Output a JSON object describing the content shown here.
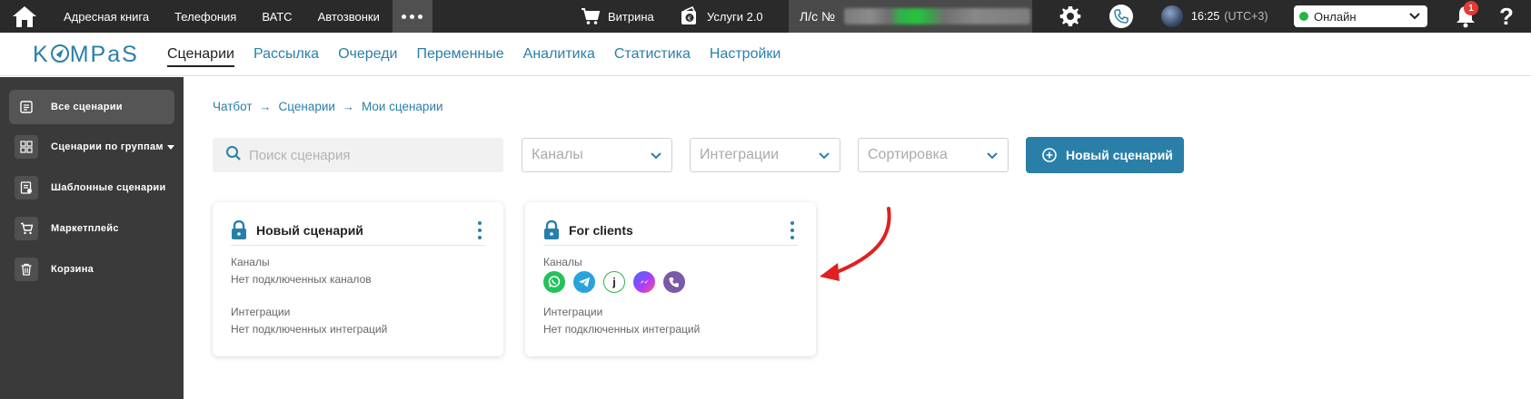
{
  "topbar": {
    "nav": [
      "Адресная книга",
      "Телефония",
      "ВАТС",
      "Автозвонки"
    ],
    "vitrina": "Витрина",
    "services": "Услуги 2.0",
    "account_label": "Л/с №",
    "time": "16:25",
    "timezone": "(UTC+3)",
    "status": "Онлайн",
    "notifications": "1",
    "help": "?"
  },
  "secbar": {
    "logo": {
      "k": "K",
      "m": "MP",
      "a": "a",
      "s": "S"
    },
    "tabs": [
      "Сценарии",
      "Рассылка",
      "Очереди",
      "Переменные",
      "Аналитика",
      "Статистика",
      "Настройки"
    ],
    "active_tab": "Сценарии"
  },
  "sidebar": {
    "items": [
      {
        "label": "Все сценарии",
        "icon": "list-icon"
      },
      {
        "label": "Сценарии по группам",
        "icon": "grid-icon"
      },
      {
        "label": "Шаблонные сценарии",
        "icon": "template-icon"
      },
      {
        "label": "Маркетплейс",
        "icon": "cart-icon"
      },
      {
        "label": "Корзина",
        "icon": "trash-icon"
      }
    ]
  },
  "breadcrumb": [
    "Чатбот",
    "Сценарии",
    "Мои сценарии"
  ],
  "filters": {
    "search_placeholder": "Поиск сценария",
    "channels": "Каналы",
    "integrations": "Интеграции",
    "sort": "Сортировка"
  },
  "new_button": "Новый сценарий",
  "cards": [
    {
      "title": "Новый сценарий",
      "channels_label": "Каналы",
      "channels_value": "Нет подключенных каналов",
      "integrations_label": "Интеграции",
      "integrations_value": "Нет подключенных интеграций"
    },
    {
      "title": "For clients",
      "channels_label": "Каналы",
      "channels": [
        "whatsapp-icon",
        "telegram-icon",
        "jivo-icon",
        "messenger-icon",
        "viber-icon"
      ],
      "jivo_glyph": "j",
      "integrations_label": "Интеграции",
      "integrations_value": "Нет подключенных интеграций"
    }
  ],
  "colors": {
    "accent": "#2a7fa8",
    "topbar": "#2a2a2a",
    "sidebar": "#3a3a3a",
    "online": "#27b34a",
    "badge": "#e53935",
    "arrow": "#e02020"
  }
}
